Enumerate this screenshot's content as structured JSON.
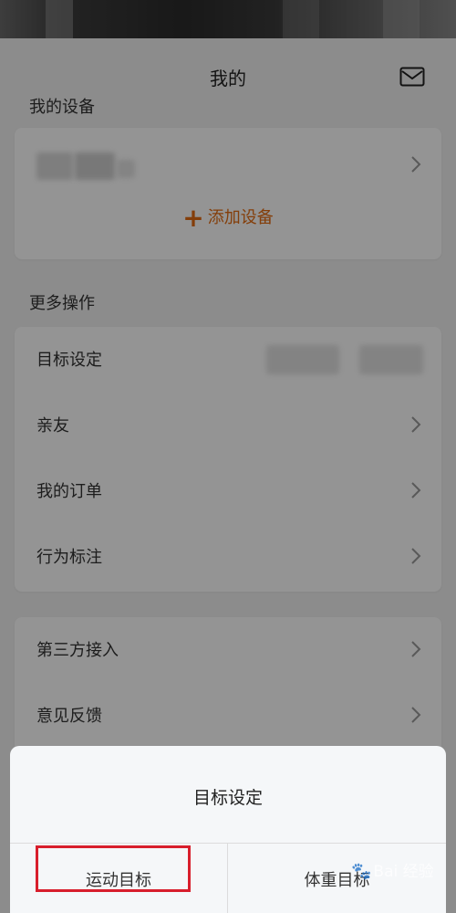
{
  "header": {
    "title": "我的"
  },
  "icons": {
    "mail": "envelope-icon",
    "chevron": "chevron-right-icon",
    "add": "plus-icon"
  },
  "colors": {
    "accent": "#e36c12",
    "highlight_border": "#d81e2c"
  },
  "devices": {
    "section_title": "我的设备",
    "add_label": "添加设备"
  },
  "more": {
    "section_title": "更多操作",
    "items": [
      {
        "label": "目标设定"
      },
      {
        "label": "亲友"
      },
      {
        "label": "我的订单"
      },
      {
        "label": "行为标注"
      }
    ]
  },
  "other": {
    "items": [
      {
        "label": "第三方接入"
      },
      {
        "label": "意见反馈"
      }
    ]
  },
  "sheet": {
    "title": "目标设定",
    "options": [
      {
        "label": "运动目标"
      },
      {
        "label": "体重目标"
      }
    ]
  },
  "watermark": {
    "text": "Bai 经验"
  }
}
